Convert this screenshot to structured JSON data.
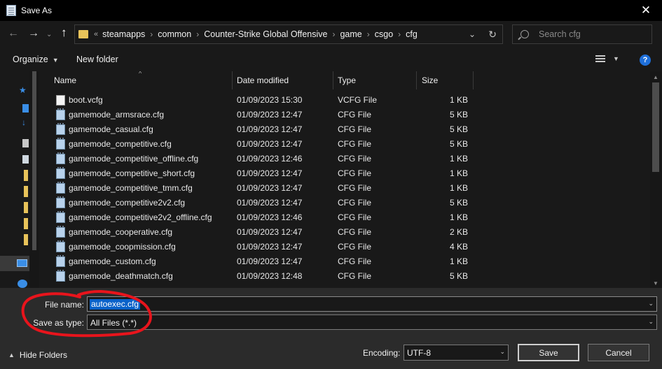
{
  "window": {
    "title": "Save As",
    "close_symbol": "✕"
  },
  "nav": {
    "back_symbol": "←",
    "forward_symbol": "→",
    "recent_symbol": "⌄",
    "up_symbol": "↑",
    "overflow_symbol": "«",
    "breadcrumbs": [
      "steamapps",
      "common",
      "Counter-Strike Global Offensive",
      "game",
      "csgo",
      "cfg"
    ],
    "separator": "›",
    "refresh_symbol": "↻",
    "dropdown_symbol": "⌄"
  },
  "search": {
    "placeholder": "Search cfg"
  },
  "toolbar": {
    "organize_label": "Organize",
    "organize_caret": "▼",
    "new_folder_label": "New folder",
    "view_caret": "▼",
    "help_label": "?"
  },
  "columns": {
    "name": "Name",
    "date": "Date modified",
    "type": "Type",
    "size": "Size",
    "sort_symbol": "^"
  },
  "files": [
    {
      "name": "boot.vcfg",
      "date": "01/09/2023 15:30",
      "type": "VCFG File",
      "size": "1 KB",
      "icon": "document-icon"
    },
    {
      "name": "gamemode_armsrace.cfg",
      "date": "01/09/2023 12:47",
      "type": "CFG File",
      "size": "5 KB",
      "icon": "cfg-file-icon"
    },
    {
      "name": "gamemode_casual.cfg",
      "date": "01/09/2023 12:47",
      "type": "CFG File",
      "size": "5 KB",
      "icon": "cfg-file-icon"
    },
    {
      "name": "gamemode_competitive.cfg",
      "date": "01/09/2023 12:47",
      "type": "CFG File",
      "size": "5 KB",
      "icon": "cfg-file-icon"
    },
    {
      "name": "gamemode_competitive_offline.cfg",
      "date": "01/09/2023 12:46",
      "type": "CFG File",
      "size": "1 KB",
      "icon": "cfg-file-icon"
    },
    {
      "name": "gamemode_competitive_short.cfg",
      "date": "01/09/2023 12:47",
      "type": "CFG File",
      "size": "1 KB",
      "icon": "cfg-file-icon"
    },
    {
      "name": "gamemode_competitive_tmm.cfg",
      "date": "01/09/2023 12:47",
      "type": "CFG File",
      "size": "1 KB",
      "icon": "cfg-file-icon"
    },
    {
      "name": "gamemode_competitive2v2.cfg",
      "date": "01/09/2023 12:47",
      "type": "CFG File",
      "size": "5 KB",
      "icon": "cfg-file-icon"
    },
    {
      "name": "gamemode_competitive2v2_offline.cfg",
      "date": "01/09/2023 12:46",
      "type": "CFG File",
      "size": "1 KB",
      "icon": "cfg-file-icon"
    },
    {
      "name": "gamemode_cooperative.cfg",
      "date": "01/09/2023 12:47",
      "type": "CFG File",
      "size": "2 KB",
      "icon": "cfg-file-icon"
    },
    {
      "name": "gamemode_coopmission.cfg",
      "date": "01/09/2023 12:47",
      "type": "CFG File",
      "size": "4 KB",
      "icon": "cfg-file-icon"
    },
    {
      "name": "gamemode_custom.cfg",
      "date": "01/09/2023 12:47",
      "type": "CFG File",
      "size": "1 KB",
      "icon": "cfg-file-icon"
    },
    {
      "name": "gamemode_deathmatch.cfg",
      "date": "01/09/2023 12:48",
      "type": "CFG File",
      "size": "5 KB",
      "icon": "cfg-file-icon"
    }
  ],
  "bottom": {
    "file_name_label": "File name:",
    "file_name_value": "autoexec.cfg",
    "save_as_type_label": "Save as type:",
    "save_as_type_value": "All Files  (*.*)",
    "hide_folders_label": "Hide Folders",
    "hide_folders_symbol": "▲",
    "encoding_label": "Encoding:",
    "encoding_value": "UTF-8",
    "save_label": "Save",
    "cancel_label": "Cancel",
    "dropdown_symbol": "⌄"
  },
  "colors": {
    "accent": "#0a62c9",
    "annotation": "#e8141c",
    "folder": "#e8c35a"
  }
}
